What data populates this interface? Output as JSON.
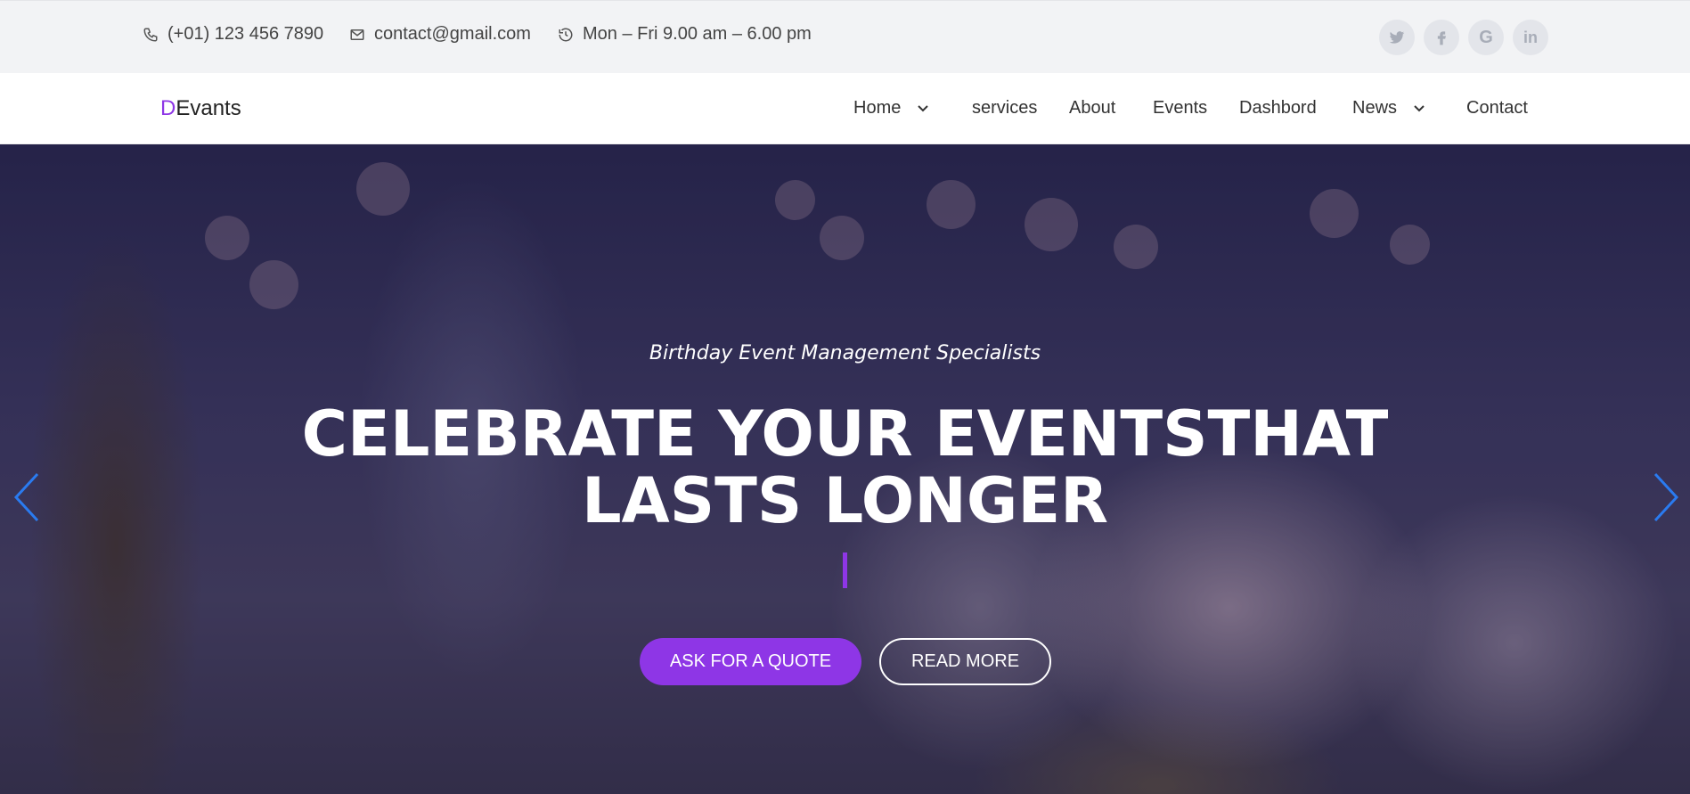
{
  "topbar": {
    "phone": "(+01) 123 456 7890",
    "email": "contact@gmail.com",
    "hours": "Mon – Fri 9.00 am – 6.00 pm",
    "social": [
      "twitter-icon",
      "facebook-icon",
      "google-icon",
      "linkedin-icon"
    ]
  },
  "navbar": {
    "logo_accent": "D",
    "logo_rest": "Evants",
    "items": [
      {
        "label": "Home",
        "dropdown": true
      },
      {
        "label": "services",
        "dropdown": false
      },
      {
        "label": "About",
        "dropdown": false
      },
      {
        "label": "Events",
        "dropdown": false
      },
      {
        "label": "Dashbord",
        "dropdown": false
      },
      {
        "label": "News",
        "dropdown": true
      },
      {
        "label": "Contact",
        "dropdown": false
      }
    ]
  },
  "hero": {
    "subtitle": "Birthday Event Management Specialists",
    "headline_line1": "CELEBRATE YOUR EVENTSTHAT",
    "headline_line2": "LASTS LONGER",
    "primary_button": "ASK FOR A QUOTE",
    "secondary_button": "READ MORE"
  },
  "colors": {
    "accent": "#8e36e6",
    "arrow": "#2a7bf0"
  }
}
